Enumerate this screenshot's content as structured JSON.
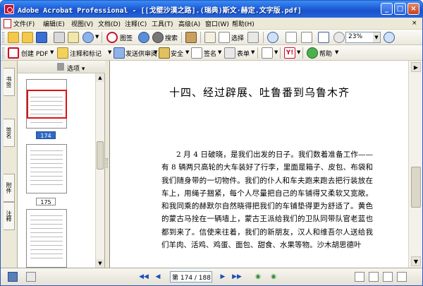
{
  "window": {
    "title": "Adobe Acrobat Professional - [[戈壁沙漠之路].(瑞典)斯文·赫定.文字版.pdf]",
    "min_label": "_",
    "max_label": "□",
    "close_label": "×"
  },
  "menu": {
    "items": [
      "文件(F)",
      "编辑(E)",
      "视图(V)",
      "文档(D)",
      "注释(C)",
      "工具(T)",
      "高级(A)",
      "窗口(W)",
      "帮助(H)"
    ],
    "close_label": "×"
  },
  "toolbar1": {
    "create_label": "图签",
    "search_label": "搜索",
    "select_label": "选择",
    "zoom_value": "23%",
    "zoom_arrow": "▼"
  },
  "toolbar2": {
    "create_pdf_label": "创建 PDF",
    "comment_label": "注释和标记",
    "send_label": "发送供审阅",
    "secure_label": "安全",
    "sign_label": "签名",
    "forms_label": "表单",
    "help_label": "帮助",
    "arrow": "▼"
  },
  "navtabs": {
    "items": [
      "书签",
      "签名",
      "附件",
      "注释"
    ]
  },
  "thumbnails": {
    "options_label": "选项 ▾",
    "pages": [
      {
        "number": "174",
        "selected": true
      },
      {
        "number": "175",
        "selected": false
      }
    ]
  },
  "document": {
    "chapter_title": "十四、经过辟展、吐鲁番到乌鲁木齐",
    "paragraph": "2 月 4 日破晓，是我们出发的日子。我们数着准备工作——有 8 辆两只高轮的大车装好了行李，里面是箱子、皮包、布袋和我们随身带的一切物件。我们的仆人和车夫跑来跑去把行装放在车上，用绳子捆紧，每个人尽量把自己的车铺得又柔软又宽敞。和我同乘的赫默尔自然晓得把我们的车铺垫得更为舒适了。黄色的蒙古马拴在一辆墙上，蒙古王派给我们的卫队同带队官老蓝也都到来了。信使来往着，我们的新朋友，汉人和维吾尔人送给我们羊肉、活鸡、鸡蛋、面包、甜食、水果等物。沙木胡思德叶"
  },
  "statusbar": {
    "page_field": "第 174 / 188 页",
    "first": "◀◀",
    "prev": "◀",
    "next": "▶",
    "last": "▶▶",
    "back": "◉",
    "forward": "◉"
  },
  "colors": {
    "titlebar": "#1f5fd8",
    "selection": "#316ac5",
    "thumb_frame": "#e01010",
    "acrobat_red": "#c8102e"
  }
}
